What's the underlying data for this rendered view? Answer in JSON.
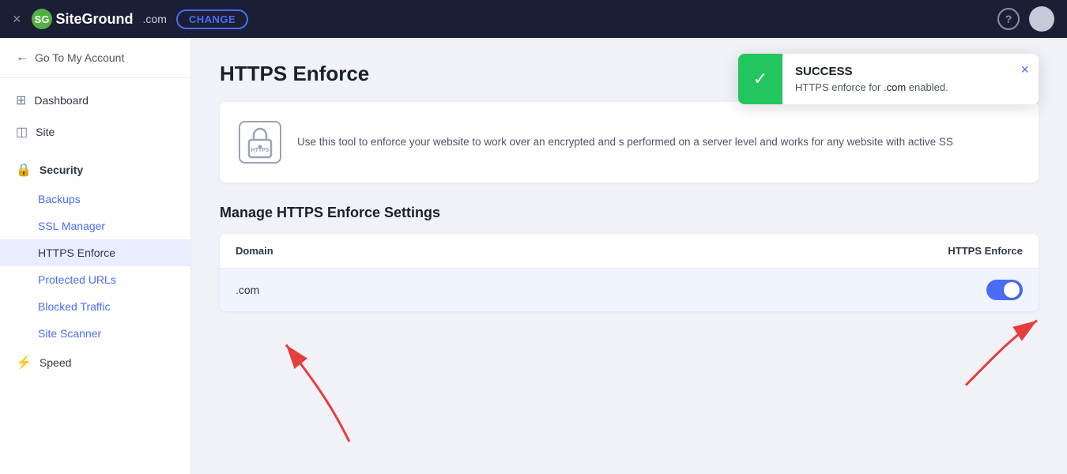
{
  "topNav": {
    "closeIcon": "×",
    "logoText": "SiteGround",
    "domainText": ".com",
    "changeLabel": "CHANGE",
    "helpIcon": "?",
    "avatarAlt": "user avatar"
  },
  "sidebar": {
    "goToAccount": "Go To My Account",
    "items": [
      {
        "id": "dashboard",
        "label": "Dashboard",
        "icon": "⊞"
      },
      {
        "id": "site",
        "label": "Site",
        "icon": "◫"
      }
    ],
    "security": {
      "label": "Security",
      "icon": "🔒",
      "subItems": [
        {
          "id": "backups",
          "label": "Backups",
          "active": false
        },
        {
          "id": "ssl-manager",
          "label": "SSL Manager",
          "active": false
        },
        {
          "id": "https-enforce",
          "label": "HTTPS Enforce",
          "active": true
        },
        {
          "id": "protected-urls",
          "label": "Protected URLs",
          "active": false
        },
        {
          "id": "blocked-traffic",
          "label": "Blocked Traffic",
          "active": false
        },
        {
          "id": "site-scanner",
          "label": "Site Scanner",
          "active": false
        }
      ]
    },
    "speed": {
      "label": "Speed",
      "icon": "⚡"
    }
  },
  "content": {
    "pageTitle": "HTTPS Enforce",
    "infoText": "Use this tool to enforce your website to work over an encrypted and s performed on a server level and works for any website with active SS",
    "manageTitle": "Manage HTTPS Enforce Settings",
    "table": {
      "col1": "Domain",
      "col2": "HTTPS Enforce",
      "rows": [
        {
          "domain": ".com",
          "httpsEnforce": true
        }
      ]
    }
  },
  "toast": {
    "title": "SUCCESS",
    "message": "HTTPS enforce for",
    "domain": ".com",
    "messageSuffix": "enabled.",
    "closeIcon": "×"
  }
}
